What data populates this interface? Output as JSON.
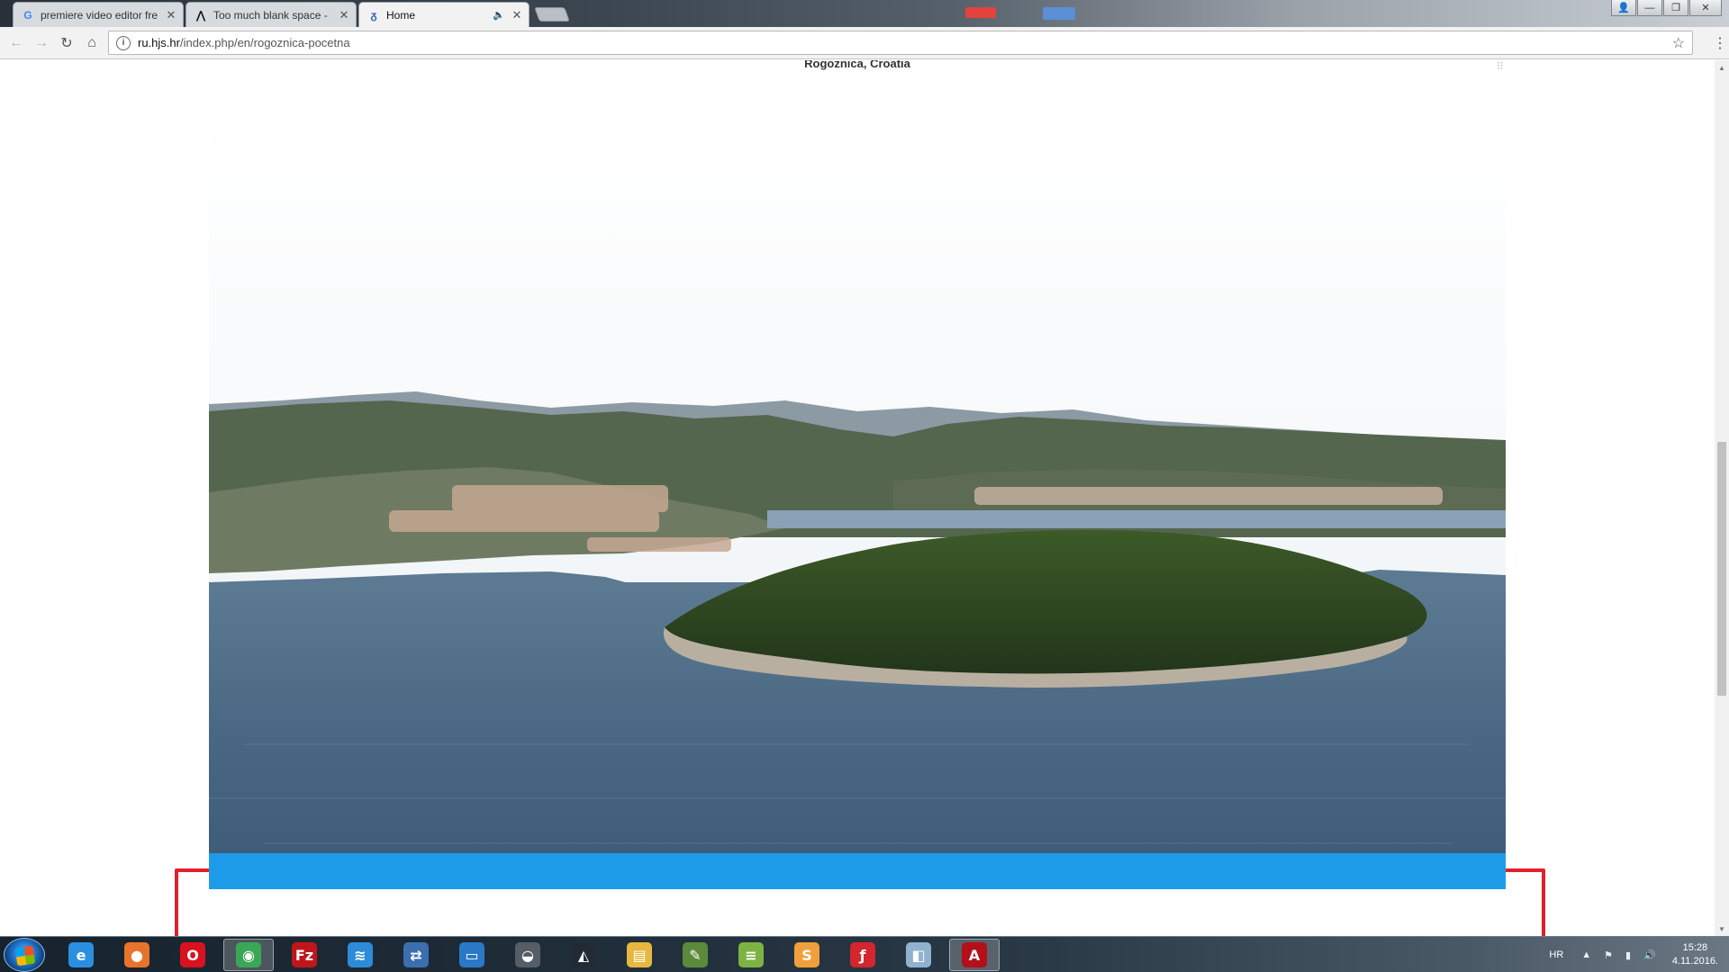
{
  "browser": {
    "tabs": [
      {
        "favicon": "google-icon",
        "favicon_glyph": "G",
        "title": "premiere video editor fre",
        "close": "✕"
      },
      {
        "favicon": "adobe-forum-icon",
        "favicon_glyph": "⋀",
        "title": "Too much blank space -",
        "close": "✕"
      },
      {
        "favicon": "site-logo-icon",
        "favicon_glyph": "ᵹ",
        "title": "Home",
        "mute": "🔈",
        "close": "✕",
        "active": true
      }
    ],
    "window_controls": {
      "profile": "👤",
      "minimize": "—",
      "maximize": "❐",
      "close": "✕"
    },
    "nav": {
      "back": "←",
      "forward": "→",
      "reload": "↻",
      "home": "⌂"
    },
    "url": {
      "host": "ru.hjs.hr",
      "path": "/index.php/en/rogoznica-pocetna"
    },
    "star": "☆",
    "menu": "⋮"
  },
  "page": {
    "caption": "Rogoznica, Croatia",
    "share": "⠿",
    "colors": {
      "letterbox": "#000000",
      "blue_bar": "#1d9be8",
      "highlight": "#e2202c"
    }
  },
  "scrollbar": {
    "up": "▲",
    "down": "▼"
  },
  "taskbar": {
    "apps": [
      {
        "name": "internet-explorer-icon",
        "glyph": "e",
        "color": "#2a8fe0"
      },
      {
        "name": "firefox-icon",
        "glyph": "●",
        "color": "#e8732a"
      },
      {
        "name": "opera-icon",
        "glyph": "O",
        "color": "#d8121f"
      },
      {
        "name": "chrome-icon",
        "glyph": "◉",
        "color": "#3aa757",
        "active": true
      },
      {
        "name": "filezilla-icon",
        "glyph": "Fz",
        "color": "#c0161b"
      },
      {
        "name": "wifi-icon",
        "glyph": "≋",
        "color": "#2e8bd8"
      },
      {
        "name": "network-icon",
        "glyph": "⇄",
        "color": "#3b6fb0"
      },
      {
        "name": "remote-desktop-icon",
        "glyph": "▭",
        "color": "#2b78c6"
      },
      {
        "name": "media-player-icon",
        "glyph": "◒",
        "color": "#555d66"
      },
      {
        "name": "unity-icon",
        "glyph": "◭",
        "color": "#222a33"
      },
      {
        "name": "file-explorer-icon",
        "glyph": "▤",
        "color": "#e7b740"
      },
      {
        "name": "paint-icon",
        "glyph": "✎",
        "color": "#5b8a3a"
      },
      {
        "name": "notepad-icon",
        "glyph": "≡",
        "color": "#7cb342"
      },
      {
        "name": "sublime-icon",
        "glyph": "S",
        "color": "#f0a03a"
      },
      {
        "name": "flash-icon",
        "glyph": "ƒ",
        "color": "#d3262e"
      },
      {
        "name": "window-icon",
        "glyph": "◧",
        "color": "#8fb3cf"
      },
      {
        "name": "acrobat-icon",
        "glyph": "A",
        "color": "#b3101a",
        "active": true
      }
    ],
    "tray": {
      "lang": "HR",
      "arrow": "▲",
      "flag": "⚑",
      "signal": "▮",
      "volume": "🔊",
      "time": "15:28",
      "date": "4.11.2016."
    }
  }
}
